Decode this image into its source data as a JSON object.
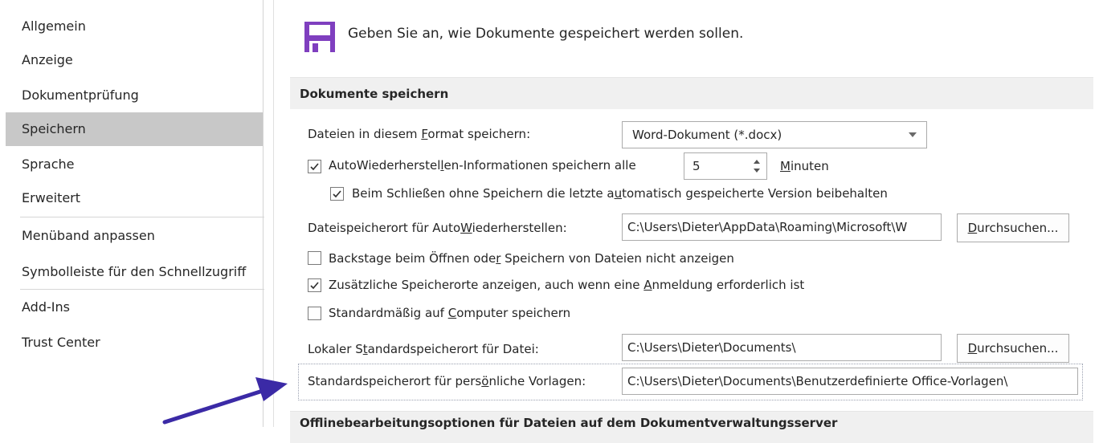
{
  "sidebar": {
    "items": [
      {
        "label": "Allgemein"
      },
      {
        "label": "Anzeige"
      },
      {
        "label": "Dokumentprüfung"
      },
      {
        "label": "Speichern"
      },
      {
        "label": "Sprache"
      },
      {
        "label": "Erweitert"
      },
      {
        "label": "Menüband anpassen"
      },
      {
        "label": "Symbolleiste für den Schnellzugriff"
      },
      {
        "label": "Add-Ins"
      },
      {
        "label": "Trust Center"
      }
    ],
    "active": "Speichern"
  },
  "main": {
    "intro": "Geben Sie an, wie Dokumente gespeichert werden sollen.",
    "section_title": "Dokumente speichern",
    "next_section_title": "Offlinebearbeitungsoptionen für Dateien auf dem Dokumentverwaltungsserver",
    "format": {
      "label_pre": "Dateien in diesem ",
      "label_u": "F",
      "label_post": "ormat speichern:",
      "value": "Word-Dokument (*.docx)"
    },
    "autorecover": {
      "checked": true,
      "label_pre": "AutoWiederherstel",
      "label_u": "l",
      "label_post": "en-Informationen speichern alle",
      "minutes_value": "5",
      "minutes_u": "M",
      "minutes_post": "inuten"
    },
    "keep_last": {
      "checked": true,
      "label_pre": "Beim Schließen ohne Speichern die letzte a",
      "label_u": "u",
      "label_post": "tomatisch gespeicherte Version beibehalten"
    },
    "autorecover_location": {
      "label_pre": "Dateispeicherort für Auto",
      "label_u": "W",
      "label_post": "iederherstellen:",
      "value": "C:\\Users\\Dieter\\AppData\\Roaming\\Microsoft\\W",
      "button_u": "D",
      "button_post": "urchsuchen..."
    },
    "no_backstage": {
      "checked": false,
      "label_pre": "Backstage beim Öffnen ode",
      "label_u": "r",
      "label_post": " Speichern von Dateien nicht anzeigen"
    },
    "extra_locations": {
      "checked": true,
      "label_pre": "Zusätzliche Speicherorte anzeigen, auch wenn eine ",
      "label_u": "A",
      "label_post": "nmeldung erforderlich ist"
    },
    "save_computer": {
      "checked": false,
      "label_pre": "Standardmäßig auf ",
      "label_u": "C",
      "label_post": "omputer speichern"
    },
    "local_default": {
      "label_pre": "Lokaler S",
      "label_u": "t",
      "label_post": "andardspeicherort für Datei:",
      "value": "C:\\Users\\Dieter\\Documents\\",
      "button_u": "D",
      "button_post": "urchsuchen..."
    },
    "templates": {
      "label_pre": "Standardspeicherort für pers",
      "label_u": "ö",
      "label_post": "nliche Vorlagen:",
      "value": "C:\\Users\\Dieter\\Documents\\Benutzerdefinierte Office-Vorlagen\\"
    }
  },
  "colors": {
    "accent": "#7f3fbf",
    "arrow": "#3b2aa6",
    "active_nav": "#c8c8c8"
  }
}
